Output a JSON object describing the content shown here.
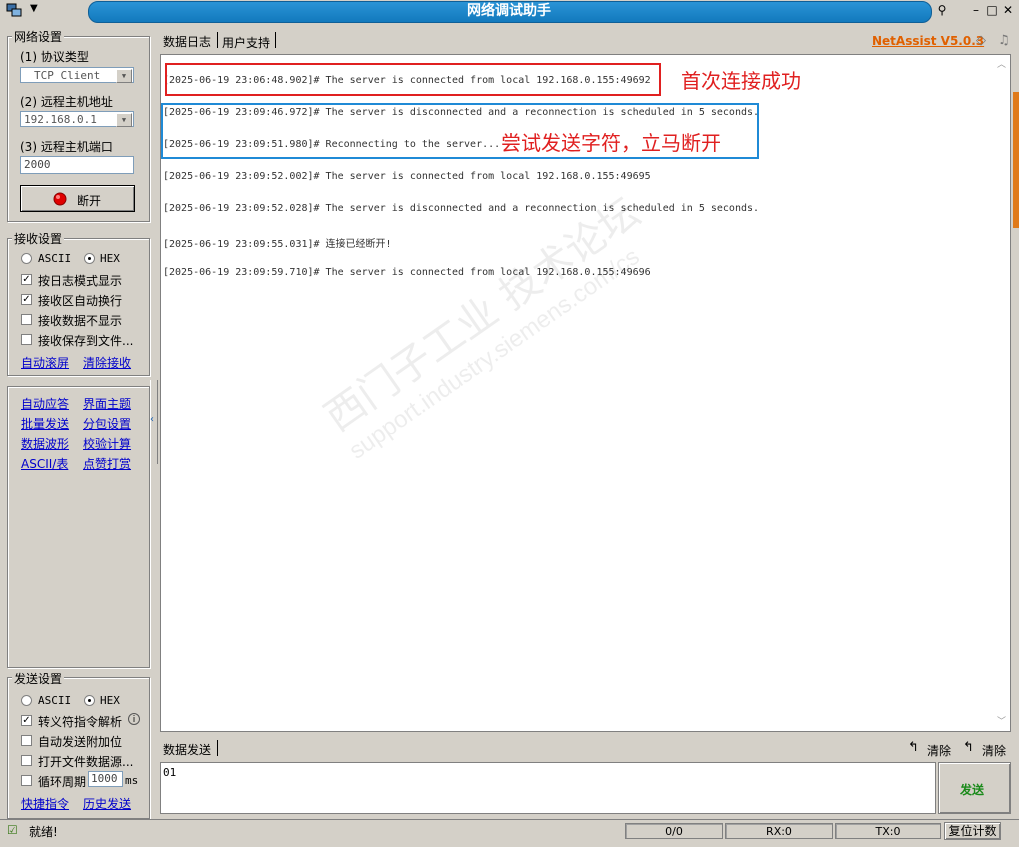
{
  "window": {
    "title": "网络调试助手"
  },
  "left": {
    "net_settings": {
      "title": "网络设置",
      "protocol_label": "(1) 协议类型",
      "protocol_value": "TCP Client",
      "host_label": "(2) 远程主机地址",
      "host_value": "192.168.0.1",
      "port_label": "(3) 远程主机端口",
      "port_value": "2000",
      "connect_button": "断开"
    },
    "recv_settings": {
      "title": "接收设置",
      "ascii": "ASCII",
      "hex": "HEX",
      "opt1": "按日志模式显示",
      "opt2": "接收区自动换行",
      "opt3": "接收数据不显示",
      "opt4": "接收保存到文件...",
      "link_autoscroll": "自动滚屏",
      "link_clear": "清除接收"
    },
    "tools": {
      "items": [
        "自动应答",
        "界面主题",
        "批量发送",
        "分包设置",
        "数据波形",
        "校验计算",
        "ASCII/表",
        "点赞打赏"
      ]
    },
    "send_settings": {
      "title": "发送设置",
      "ascii": "ASCII",
      "hex": "HEX",
      "opt1": "转义符指令解析",
      "opt2": "自动发送附加位",
      "opt3": "打开文件数据源...",
      "opt4": "循环周期",
      "period_value": "1000",
      "period_unit": "ms",
      "link_shortcut": "快捷指令",
      "link_history": "历史发送"
    }
  },
  "tabs": {
    "log": "数据日志",
    "support": "用户支持"
  },
  "brand": "NetAssist V5.0.3",
  "log_lines": [
    "[2025-06-19 23:06:48.902]# The server is connected from local 192.168.0.155:49692",
    "[2025-06-19 23:09:46.972]# The server is disconnected and a reconnection is scheduled in 5 seconds.",
    "[2025-06-19 23:09:51.980]# Reconnecting to the server...",
    "[2025-06-19 23:09:52.002]# The server is connected from local 192.168.0.155:49695",
    "[2025-06-19 23:09:52.028]# The server is disconnected and a reconnection is scheduled in 5 seconds.",
    "[2025-06-19 23:09:55.031]# 连接已经断开!",
    "[2025-06-19 23:09:59.710]# The server is connected from local 192.168.0.155:49696"
  ],
  "annotations": {
    "first": "首次连接成功",
    "second": "尝试发送字符，立马断开"
  },
  "watermark": {
    "line1": "西门子工业 技术论坛",
    "line2": "support.industry.siemens.com/cs"
  },
  "send": {
    "tab": "数据发送",
    "clear1": "清除",
    "clear2": "清除",
    "content": "01",
    "button": "发送"
  },
  "status": {
    "ready": "就绪!",
    "counter": "0/0",
    "rx": "RX:0",
    "tx": "TX:0",
    "reset": "复位计数"
  },
  "colors": {
    "title_blue": "#1a86c9",
    "annotation_red": "#e02020",
    "annotation_blue": "#1f8ad6",
    "brand": "#e06000",
    "send_green": "#1a8a1a"
  }
}
